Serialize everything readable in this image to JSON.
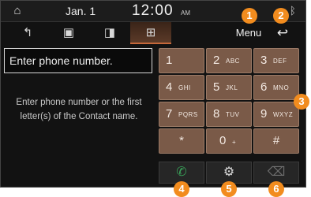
{
  "status": {
    "home_icon": "home-icon",
    "date": "Jan. 1",
    "time": "12:00",
    "ampm": "AM",
    "bluetooth_icon": "bluetooth-icon"
  },
  "tabs": [
    {
      "icon": "call-history-icon",
      "glyph": "↰",
      "active": false
    },
    {
      "icon": "contacts-icon",
      "glyph": "▣",
      "active": false
    },
    {
      "icon": "favorites-icon",
      "glyph": "◨",
      "active": false
    },
    {
      "icon": "keypad-icon",
      "glyph": "⊞",
      "active": true
    }
  ],
  "header": {
    "menu_label": "Menu",
    "back_glyph": "↩"
  },
  "input": {
    "placeholder": "Enter phone number."
  },
  "hint": "Enter phone number or the first letter(s) of the Contact name.",
  "keypad": [
    {
      "num": "1",
      "sub": ""
    },
    {
      "num": "2",
      "sub": "ABC"
    },
    {
      "num": "3",
      "sub": "DEF"
    },
    {
      "num": "4",
      "sub": "GHI"
    },
    {
      "num": "5",
      "sub": "JKL"
    },
    {
      "num": "6",
      "sub": "MNO"
    },
    {
      "num": "7",
      "sub": "PQRS"
    },
    {
      "num": "8",
      "sub": "TUV"
    },
    {
      "num": "9",
      "sub": "WXYZ"
    },
    {
      "num": "*",
      "sub": ""
    },
    {
      "num": "0",
      "sub": "+"
    },
    {
      "num": "#",
      "sub": ""
    }
  ],
  "actions": {
    "call": {
      "glyph": "✆",
      "color": "#3aa35a"
    },
    "settings": {
      "glyph": "⚙",
      "color": "#dcdcdc"
    },
    "delete": {
      "glyph": "⌫",
      "color": "#6e6e6e"
    }
  },
  "callouts": [
    "1",
    "2",
    "3",
    "4",
    "5",
    "6"
  ],
  "colors": {
    "accent": "#c5683a",
    "callout": "#f28c1e",
    "key": "#7a5a48"
  }
}
